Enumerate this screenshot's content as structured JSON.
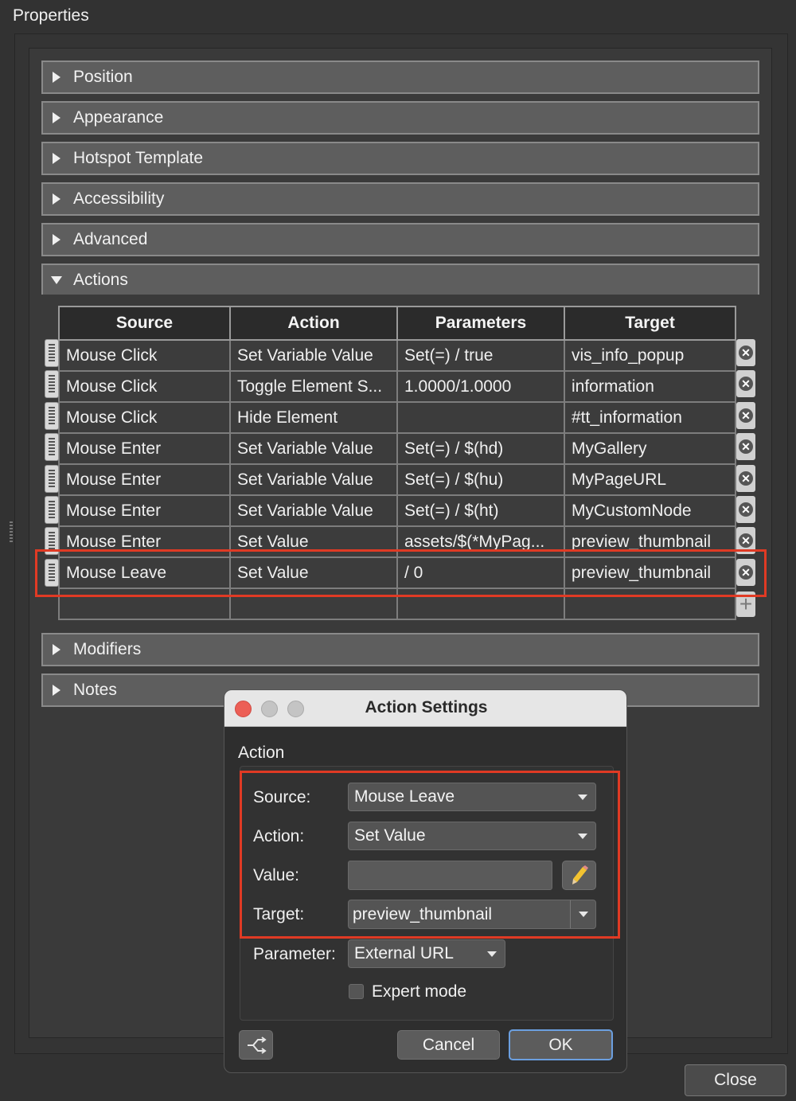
{
  "window_title": "Properties",
  "sections": [
    {
      "label": "Position",
      "expanded": false
    },
    {
      "label": "Appearance",
      "expanded": false
    },
    {
      "label": "Hotspot Template",
      "expanded": false
    },
    {
      "label": "Accessibility",
      "expanded": false
    },
    {
      "label": "Advanced",
      "expanded": false
    },
    {
      "label": "Actions",
      "expanded": true
    },
    {
      "label": "Modifiers",
      "expanded": false
    },
    {
      "label": "Notes",
      "expanded": false
    }
  ],
  "actions_table": {
    "columns": [
      "Source",
      "Action",
      "Parameters",
      "Target"
    ],
    "rows": [
      [
        "Mouse Click",
        "Set Variable Value",
        "Set(=) / true",
        "vis_info_popup"
      ],
      [
        "Mouse Click",
        "Toggle Element S...",
        "1.0000/1.0000",
        "information"
      ],
      [
        "Mouse Click",
        "Hide Element",
        "",
        "#tt_information"
      ],
      [
        "Mouse Enter",
        "Set Variable Value",
        "Set(=) / $(hd)",
        "MyGallery"
      ],
      [
        "Mouse Enter",
        "Set Variable Value",
        "Set(=) / $(hu)",
        "MyPageURL"
      ],
      [
        "Mouse Enter",
        "Set Variable Value",
        "Set(=) / $(ht)",
        "MyCustomNode"
      ],
      [
        "Mouse Enter",
        "Set Value",
        "assets/$(*MyPag...",
        "preview_thumbnail"
      ],
      [
        "Mouse Leave",
        "Set Value",
        " / 0",
        "preview_thumbnail"
      ]
    ],
    "delete_glyph": "✕",
    "add_glyph": "+"
  },
  "dialog": {
    "title": "Action Settings",
    "group_label": "Action",
    "source_label": "Source:",
    "source_value": "Mouse Leave",
    "action_label": "Action:",
    "action_value": "Set Value",
    "value_label": "Value:",
    "value_value": "",
    "target_label": "Target:",
    "target_value": "preview_thumbnail",
    "parameter_label": "Parameter:",
    "parameter_value": "External URL",
    "expert_mode_label": "Expert mode",
    "expert_mode_checked": false,
    "cancel_label": "Cancel",
    "ok_label": "OK"
  },
  "close_label": "Close",
  "colors": {
    "highlight": "#e03a24",
    "traffic_red": "#ec5f56",
    "traffic_gray": "#c4c4c4",
    "ok_border": "#6b9fe0"
  }
}
